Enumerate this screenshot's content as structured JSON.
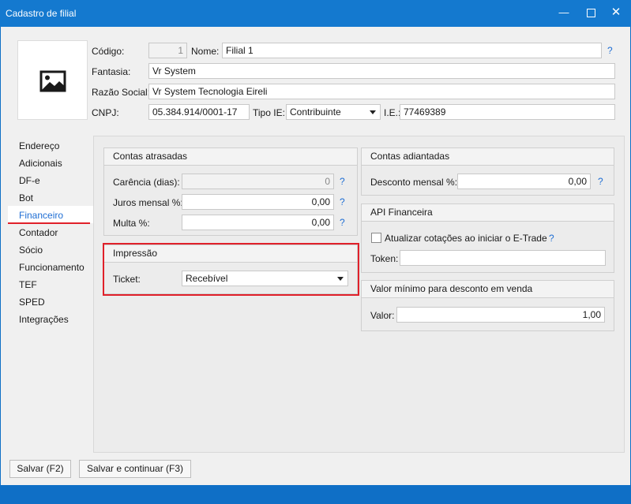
{
  "window": {
    "title": "Cadastro de filial"
  },
  "header": {
    "codigo_label": "Código:",
    "codigo_value": "1",
    "nome_label": "Nome:",
    "nome_value": "Filial 1",
    "fantasia_label": "Fantasia:",
    "fantasia_value": "Vr System",
    "razao_label": "Razão Social:",
    "razao_value": "Vr System Tecnologia Eireli",
    "cnpj_label": "CNPJ:",
    "cnpj_value": "05.384.914/0001-17",
    "tipoie_label": "Tipo IE:",
    "tipoie_value": "Contribuinte",
    "ie_label": "I.E.:",
    "ie_value": "77469389",
    "help": "?"
  },
  "sidebar": {
    "items": [
      {
        "label": "Endereço"
      },
      {
        "label": "Adicionais"
      },
      {
        "label": "DF-e"
      },
      {
        "label": "Bot"
      },
      {
        "label": "Financeiro"
      },
      {
        "label": "Contador"
      },
      {
        "label": "Sócio"
      },
      {
        "label": "Funcionamento"
      },
      {
        "label": "TEF"
      },
      {
        "label": "SPED"
      },
      {
        "label": "Integrações"
      }
    ],
    "active_index": 4
  },
  "contas_atrasadas": {
    "title": "Contas atrasadas",
    "carencia_label": "Carência (dias):",
    "carencia_value": "0",
    "juros_label": "Juros mensal %:",
    "juros_value": "0,00",
    "multa_label": "Multa %:",
    "multa_value": "0,00"
  },
  "impressao": {
    "title": "Impressão",
    "ticket_label": "Ticket:",
    "ticket_value": "Recebível"
  },
  "contas_adiantadas": {
    "title": "Contas adiantadas",
    "desconto_label": "Desconto mensal %:",
    "desconto_value": "0,00"
  },
  "api_financeira": {
    "title": "API Financeira",
    "atualizar_label": "Atualizar cotações ao iniciar o E-Trade",
    "atualizar_checked": false,
    "token_label": "Token:",
    "token_value": ""
  },
  "valor_minimo": {
    "title": "Valor mínimo para desconto em venda",
    "valor_label": "Valor:",
    "valor_value": "1,00"
  },
  "footer": {
    "salvar_label": "Salvar (F2)",
    "salvar_continuar_label": "Salvar e continuar (F3)"
  },
  "colors": {
    "accent": "#1479cf",
    "highlight": "#e0202a"
  }
}
